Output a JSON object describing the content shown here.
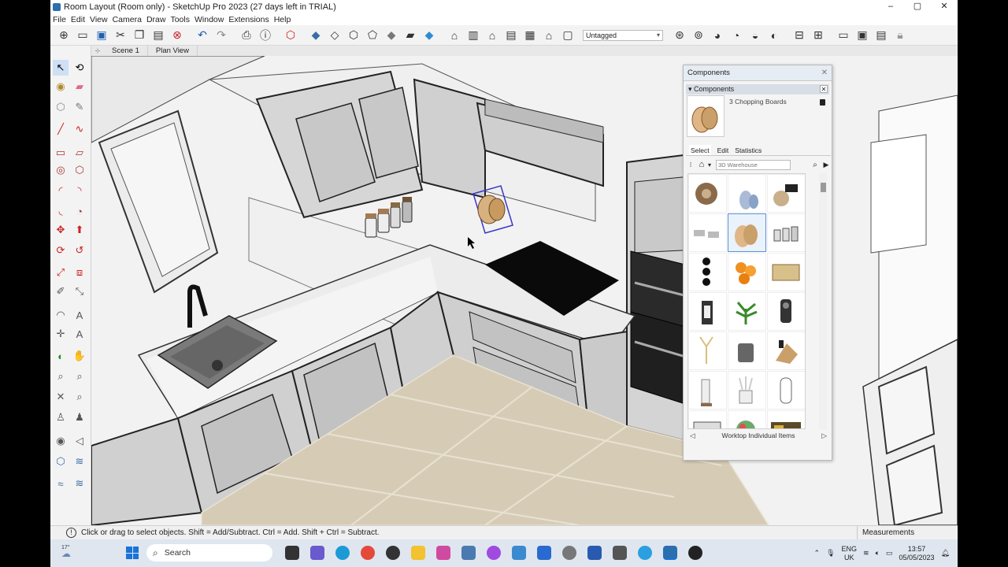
{
  "window": {
    "title": "Room Layout (Room only) - SketchUp Pro 2023 (27 days left in TRIAL)",
    "controls": [
      "–",
      "▢",
      "✕"
    ]
  },
  "menu": [
    "File",
    "Edit",
    "View",
    "Camera",
    "Draw",
    "Tools",
    "Window",
    "Extensions",
    "Help"
  ],
  "toolbar": {
    "tag_select_value": "Untagged"
  },
  "scenes": {
    "tabs": [
      "Scene 1",
      "Plan View"
    ]
  },
  "components_panel": {
    "title": "Components",
    "section_title": "Components",
    "preview_name": "3 Chopping Boards",
    "tabs": [
      "Select",
      "Edit",
      "Statistics"
    ],
    "search_placeholder": "3D Warehouse",
    "footer_label": "Worktop Individual Items"
  },
  "statusbar": {
    "hint": "Click or drag to select objects. Shift = Add/Subtract. Ctrl = Add. Shift + Ctrl = Subtract.",
    "measurements_label": "Measurements"
  },
  "taskbar": {
    "weather": "17°",
    "search_placeholder": "Search",
    "language": "ENG",
    "region": "UK",
    "time": "13:57",
    "date": "05/05/2023"
  }
}
